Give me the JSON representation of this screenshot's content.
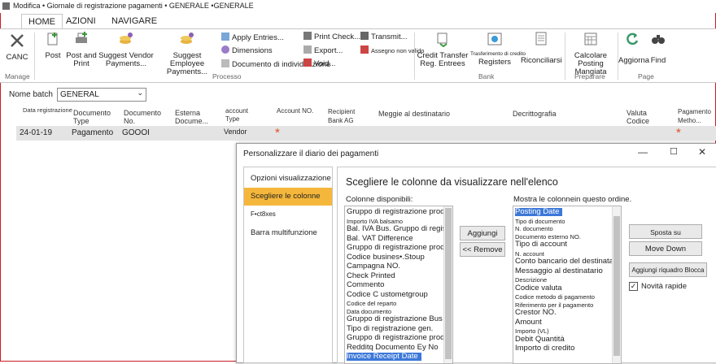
{
  "window": {
    "title": "Modifica • Giornale di registrazione pagamenti • GENERALE •GENERALE"
  },
  "tabs": [
    "HOME",
    "AZIONI",
    "NAVIGARE"
  ],
  "ribbon": {
    "canc": "CANC",
    "manage_group": "Manage",
    "post": "Post",
    "post_print": "Post and Print",
    "suggest_vendor": "Suggest Vendor Payments...",
    "suggest_employee": "Suggest Employee Payments...",
    "apply_entries": "Apply Entries...",
    "dimensions": "Dimensions",
    "doc_individuazione": "Documento di individuazione",
    "print_check": "Print Check...",
    "export": "Export...",
    "void": "Void...",
    "transmit": "Transmit...",
    "assegno_non_valido": "Assegno non valido",
    "processo_group": "Processo",
    "credit_transfer": "Credit Transfer Reg. Entrees",
    "trasferimento": "Trasferimento di credito",
    "registers": "Registers",
    "riconciliarsi": "Riconciliarsi",
    "bank_group": "Bank",
    "calcolare": "Calcolare Posting Mangiata",
    "preparare_group": "Preparare",
    "aggiorna": "Aggiorna",
    "find": "Find",
    "page_group": "Page"
  },
  "batch": {
    "label": "Nome batch",
    "value": "GENERAL"
  },
  "journal": {
    "headers": {
      "data_reg": "Data registrazione",
      "doc_type": "Documento Type",
      "doc_no": "Documento No.",
      "ext_doc": "Esterna Docume...",
      "account_type": "account Type",
      "account_no": "Account NO.",
      "recipient_bank": "Recipient Bank AG",
      "message": "Meggie al destinatario",
      "description": "Decrittografia",
      "currency": "Valuta Codice",
      "payment_method": "Pagamento Metho..."
    },
    "row": {
      "date": "24-01-19",
      "doc_type": "Pagamento",
      "doc_no": "GOOOI",
      "account_type": "Vendor",
      "required_mark": "*"
    }
  },
  "dialog": {
    "title": "Personalizzare il diario dei pagamenti",
    "nav": [
      "Opzioni visualizzazione",
      "Scegliere le colonne",
      "F•ct8xes",
      "Barra multifunzione"
    ],
    "heading": "Scegliere le colonne da visualizzare nell'elenco",
    "available_label": "Colonne disponibili:",
    "shown_label": "Mostra le colonnein questo ordine.",
    "available": [
      {
        "t": "Gruppo di registrazione prodotti gen.",
        "s": false
      },
      {
        "t": "Importo IVA balsamo",
        "s": true
      },
      {
        "t": "Bal. IVA Bus. Gruppo di registrazione",
        "s": false
      },
      {
        "t": "Bal. VAT Difference",
        "s": false
      },
      {
        "t": "Gruppo di registrazione prodotti IVA",
        "s": false
      },
      {
        "t": "Codice busines•.Stoup",
        "s": false
      },
      {
        "t": "Campagna NO.",
        "s": false
      },
      {
        "t": "Check Printed",
        "s": false
      },
      {
        "t": "Commento",
        "s": false
      },
      {
        "t": "Codice C ustometgroup",
        "s": false
      },
      {
        "t": "Codice del reparto",
        "s": true
      },
      {
        "t": "Data documento",
        "s": true
      },
      {
        "t": "Gruppo di registrazione Bus gen.",
        "s": false
      },
      {
        "t": "Tipo di registrazione gen.",
        "s": false
      },
      {
        "t": "Gruppo di registrazione prodotti gen.",
        "s": false
      },
      {
        "t": "Redditq Documento Ey No",
        "s": false
      },
      {
        "t": "Invoice Receipt Date",
        "s": false
      }
    ],
    "shown": [
      {
        "t": "Posting Date",
        "s": false
      },
      {
        "t": "Tipo di documento",
        "s": true
      },
      {
        "t": "N. documento",
        "s": true
      },
      {
        "t": "Documento esterno NO.",
        "s": true
      },
      {
        "t": "Tipo di account",
        "s": false
      },
      {
        "t": "N. account",
        "s": true
      },
      {
        "t": "Conto bancario del destinatario",
        "s": false
      },
      {
        "t": "Messaggio al destinatario",
        "s": false
      },
      {
        "t": "Descrizione",
        "s": true
      },
      {
        "t": "Codice valuta",
        "s": false
      },
      {
        "t": "Codice metodo di pagamento",
        "s": true
      },
      {
        "t": "Riferimento per il pagamento",
        "s": true
      },
      {
        "t": "Crestor NO.",
        "s": false
      },
      {
        "t": "Amount",
        "s": false
      },
      {
        "t": "Importo (VL)",
        "s": true
      },
      {
        "t": "Debit Quantità",
        "s": false
      },
      {
        "t": "Importo di credito",
        "s": false
      }
    ],
    "add_btn": "Aggiungi",
    "remove_btn": "<< Remove",
    "move_up": "Sposta su",
    "move_down": "Move Down",
    "add_freeze": "Aggiungi riquadro Blocca",
    "new_features": "Novità rapide",
    "new_features_checked": true
  }
}
